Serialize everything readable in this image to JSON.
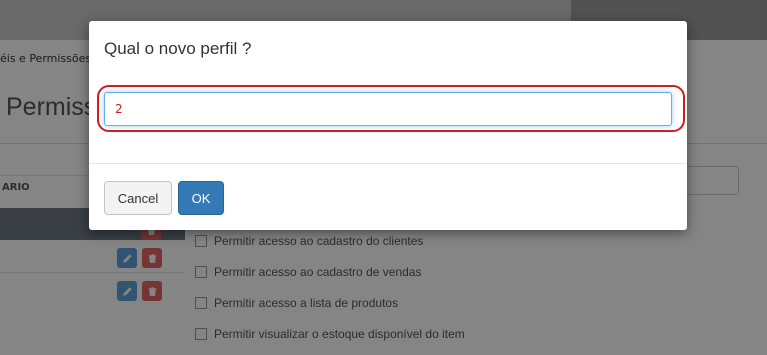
{
  "background": {
    "breadcrumb": "éis e Permissões",
    "page_title": "Permiss",
    "table_header": "ARIO",
    "permissions": [
      "Permitir acesso ao cadastro do clientes",
      "Permitir acesso ao cadastro de vendas",
      "Permitir acesso a lista de produtos",
      "Permitir visualizar o estoque disponível do item"
    ],
    "icons": {
      "edit": "pencil-icon",
      "delete": "trash-icon"
    }
  },
  "dialog": {
    "title": "Qual o novo perfil ?",
    "input_value": "2",
    "cancel_label": "Cancel",
    "ok_label": "OK"
  },
  "colors": {
    "highlight_ring": "#cc1f1f",
    "ok_button": "#337ab7",
    "edit_button": "#5fa2dd",
    "delete_button": "#e36767"
  }
}
